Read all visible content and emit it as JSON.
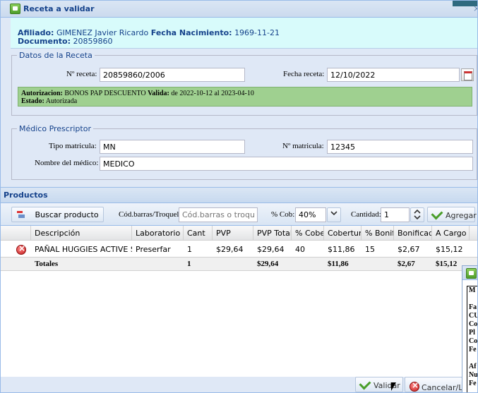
{
  "window": {
    "title": "Receta a validar",
    "close_glyph": "×"
  },
  "affiliate": {
    "afiliado_label": "Afiliado:",
    "afiliado_value": "GIMENEZ Javier Ricardo",
    "fecha_label": "Fecha Nacimiento:",
    "fecha_value": "1969-11-21",
    "documento_label": "Documento:",
    "documento_value": "20859860"
  },
  "receta": {
    "legend": "Datos de la Receta",
    "numero_label": "Nº receta:",
    "numero_value": "20859860/2006",
    "fecha_label": "Fecha receta:",
    "fecha_value": "12/10/2022",
    "auth": {
      "autorizacion_label": "Autorizacion:",
      "autorizacion_value": "BONOS PAP DESCUENTO",
      "valida_label": "Valida:",
      "valida_value": "de 2022-10-12 al 2023-04-10",
      "estado_label": "Estado:",
      "estado_value": "Autorizada"
    }
  },
  "medico": {
    "legend": "Médico Prescriptor",
    "tipo_label": "Tipo matricula:",
    "tipo_value": "MN",
    "matricula_label": "Nº matricula:",
    "matricula_value": "12345",
    "nombre_label": "Nombre del médico:",
    "nombre_value": "MEDICO"
  },
  "productos": {
    "title": "Productos",
    "toolbar": {
      "buscar_label": "Buscar producto",
      "barras_label": "Cód.barras/Troquel:",
      "barras_placeholder": "Cód.barras o troquel",
      "cob_label": "% Cob:",
      "cob_value": "40%",
      "cantidad_label": "Cantidad:",
      "cantidad_value": "1",
      "agregar_label": "Agregar"
    },
    "columns": [
      "Descripción",
      "Laboratorio",
      "Cant",
      "PVP",
      "PVP Total",
      "% Cober",
      "Cobertura",
      "% Bonifi",
      "Bonificado",
      "A Cargo"
    ],
    "rows": [
      [
        "PAÑAL HUGGIES ACTIVE SE...",
        "Preserfar",
        "1",
        "$29,64",
        "$29,64",
        "40",
        "$11,86",
        "15",
        "$2,67",
        "$15,12"
      ]
    ],
    "totals": {
      "label": "Totales",
      "cant": "1",
      "pvp_total": "$29,64",
      "cobertura": "$11,86",
      "bonificado": "$2,67",
      "a_cargo": "$15,12"
    }
  },
  "actions": {
    "validar_label": "Validar",
    "cancelar_label": "Cancelar/Limp"
  },
  "popup": {
    "lines": [
      "M",
      "",
      "Fa",
      "CU",
      "Co",
      "Pl",
      "Co",
      "Fe",
      "",
      "Af",
      "Nu",
      "Fe"
    ]
  },
  "colors": {
    "title_blue": "#15428b",
    "auth_green": "#9fd090",
    "affiliate_bg": "#d8fbfb",
    "window_bg": "#dfe8f6"
  }
}
